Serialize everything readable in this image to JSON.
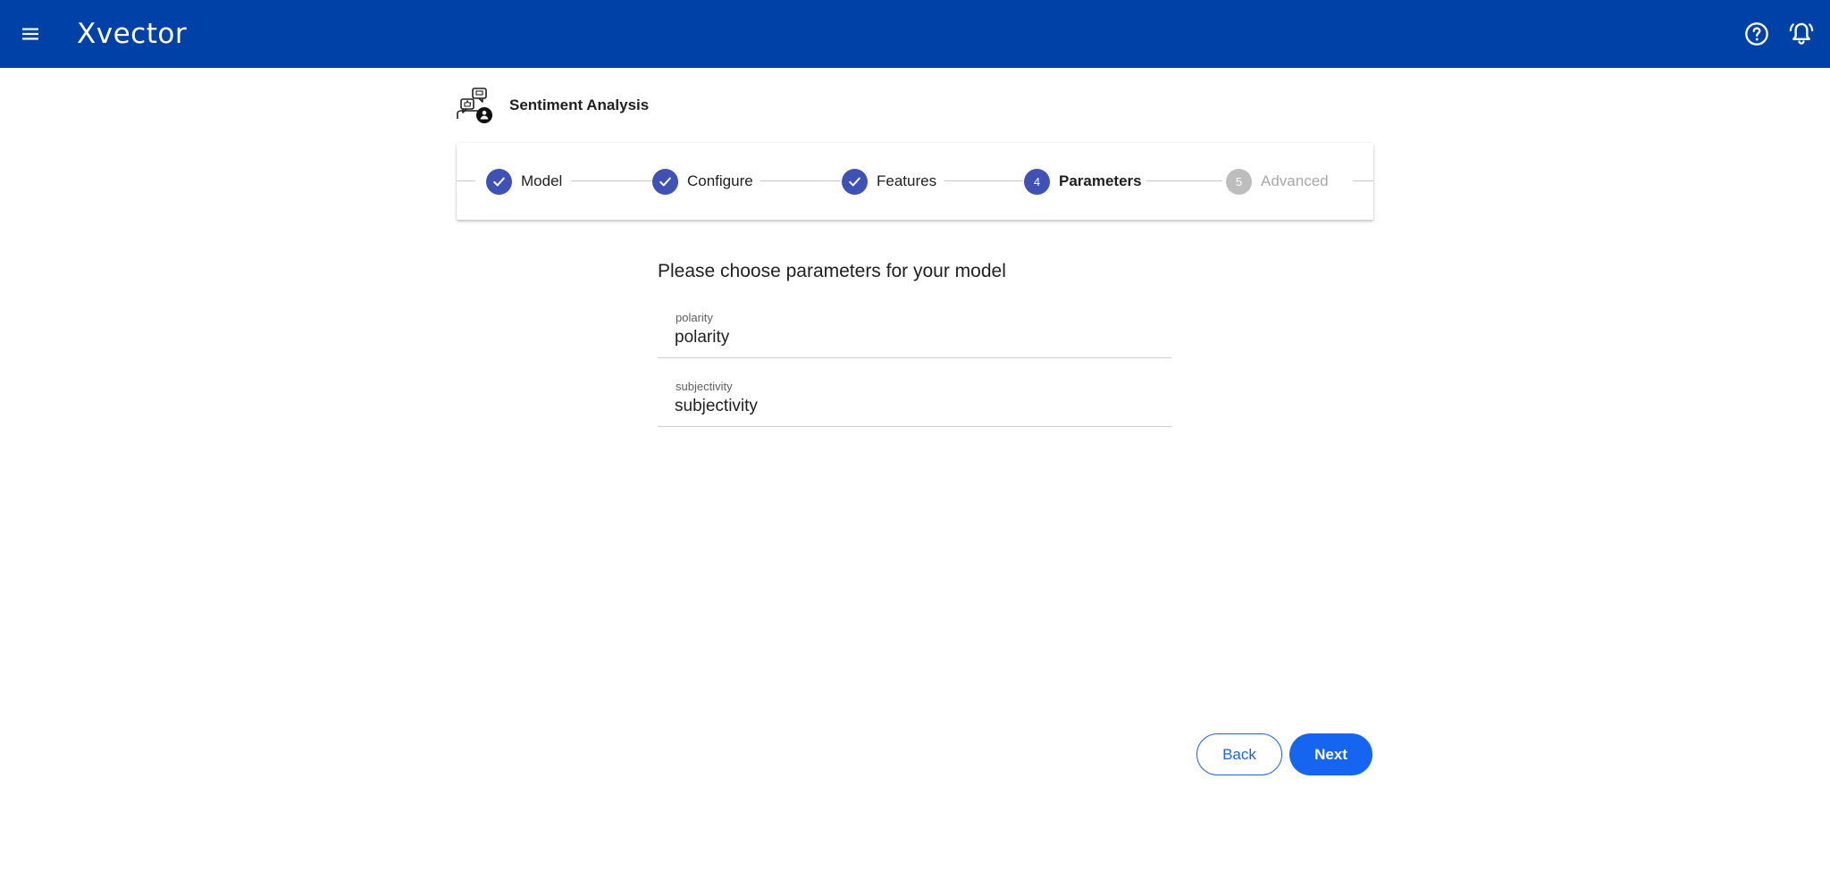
{
  "app": {
    "logo_text": "Xvector"
  },
  "topbar": {
    "menu_icon": "hamburger-menu-icon",
    "help_icon": "help-circle-icon",
    "notifications_icon": "bell-alert-icon",
    "background_color": "#0041a8"
  },
  "model": {
    "title": "Sentiment Analysis",
    "icon": "sentiment-model-icon"
  },
  "stepper": {
    "steps": [
      {
        "label": "Model",
        "state": "completed",
        "number": "1"
      },
      {
        "label": "Configure",
        "state": "completed",
        "number": "2"
      },
      {
        "label": "Features",
        "state": "completed",
        "number": "3"
      },
      {
        "label": "Parameters",
        "state": "active",
        "number": "4"
      },
      {
        "label": "Advanced",
        "state": "inactive",
        "number": "5"
      }
    ],
    "active_color": "#3f51b5",
    "inactive_color": "#bdbdbd"
  },
  "form": {
    "title": "Please choose parameters for your model",
    "fields": [
      {
        "label": "polarity",
        "value": "polarity"
      },
      {
        "label": "subjectivity",
        "value": "subjectivity"
      }
    ]
  },
  "actions": {
    "back_label": "Back",
    "next_label": "Next",
    "primary_color": "#1565f0"
  }
}
